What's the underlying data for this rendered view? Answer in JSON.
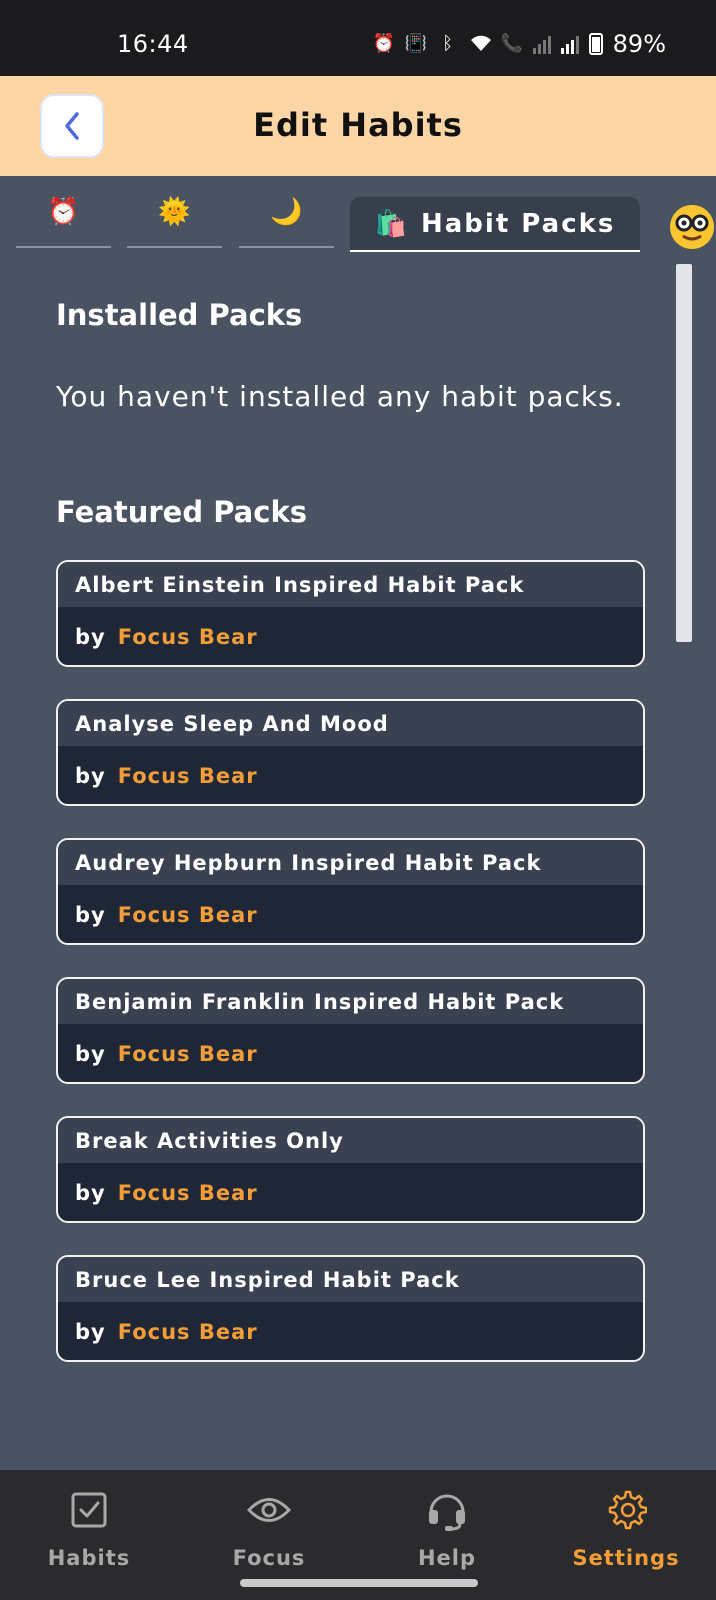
{
  "status_bar": {
    "time": "16:44",
    "battery": "89%",
    "icons": [
      "alarm-icon",
      "vibrate-icon",
      "bluetooth-icon",
      "wifi-icon",
      "wifi-call-icon",
      "signal-icon",
      "signal-icon"
    ]
  },
  "header": {
    "title": "Edit Habits",
    "back_icon": "chevron-left-icon"
  },
  "tabs": [
    {
      "icon": "alarm-clock-icon",
      "glyph": "⏰"
    },
    {
      "icon": "sun-icon",
      "glyph": "🌞"
    },
    {
      "icon": "moon-icon",
      "glyph": "🌙"
    },
    {
      "icon": "shopping-bags-icon",
      "glyph": "🛍️",
      "label": "Habit Packs",
      "active": true
    },
    {
      "icon": "nerd-face-icon",
      "glyph": "🤓"
    }
  ],
  "installed": {
    "title": "Installed Packs",
    "empty_text": "You haven't installed any habit packs."
  },
  "featured": {
    "title": "Featured Packs",
    "by_label": "by",
    "packs": [
      {
        "name": "Albert Einstein Inspired Habit Pack",
        "author": "Focus Bear"
      },
      {
        "name": "Analyse Sleep And Mood",
        "author": "Focus Bear"
      },
      {
        "name": "Audrey Hepburn Inspired Habit Pack",
        "author": "Focus Bear"
      },
      {
        "name": "Benjamin Franklin Inspired Habit Pack",
        "author": "Focus Bear"
      },
      {
        "name": "Break Activities Only",
        "author": "Focus Bear"
      },
      {
        "name": "Bruce Lee Inspired Habit Pack",
        "author": "Focus Bear"
      }
    ]
  },
  "bottom_nav": [
    {
      "label": "Habits",
      "icon": "checkbox-icon"
    },
    {
      "label": "Focus",
      "icon": "eye-icon"
    },
    {
      "label": "Help",
      "icon": "headset-icon"
    },
    {
      "label": "Settings",
      "icon": "gear-icon",
      "active": true
    }
  ],
  "colors": {
    "background": "#4a5362",
    "header": "#fed5a5",
    "accent": "#f29d38",
    "card": "#1f2736",
    "card_title": "#3a4252"
  }
}
